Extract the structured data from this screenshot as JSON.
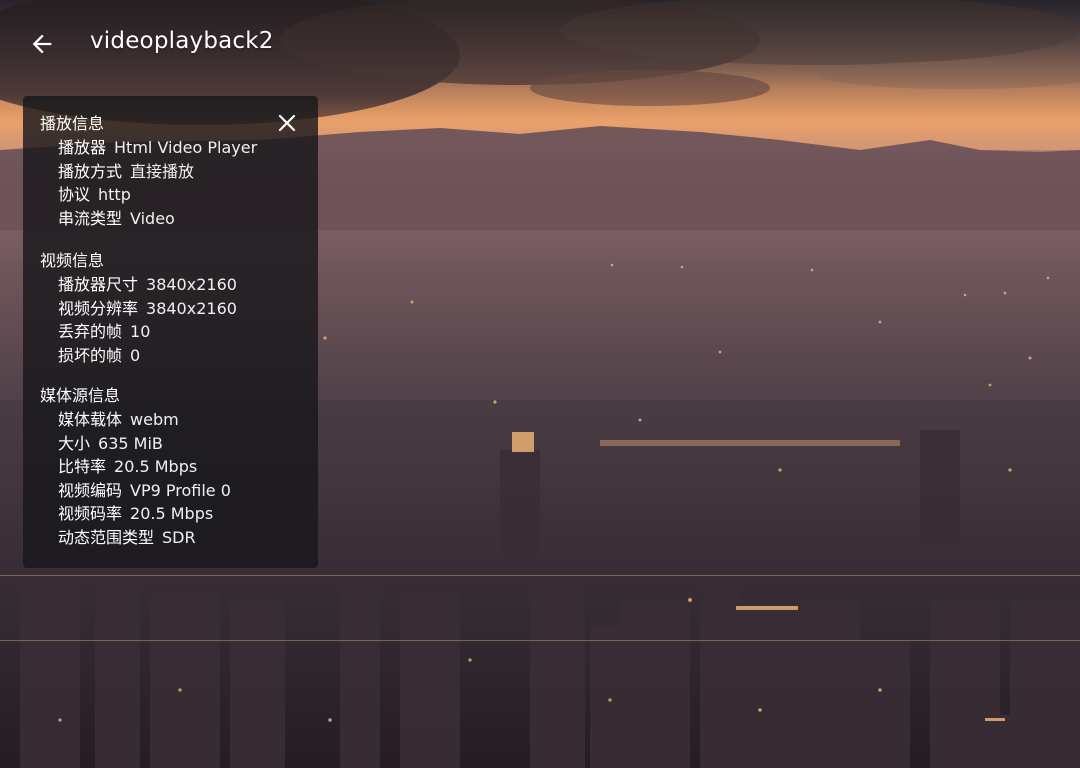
{
  "header": {
    "back_icon": "arrow-left-icon",
    "title": "videoplayback2"
  },
  "stats_panel": {
    "close_icon": "close-icon",
    "sections": [
      {
        "title": "播放信息",
        "rows": [
          {
            "label": "播放器",
            "value": "Html Video Player"
          },
          {
            "label": "播放方式",
            "value": "直接播放"
          },
          {
            "label": "协议",
            "value": "http"
          },
          {
            "label": "串流类型",
            "value": "Video"
          }
        ]
      },
      {
        "title": "视频信息",
        "rows": [
          {
            "label": "播放器尺寸",
            "value": "3840x2160"
          },
          {
            "label": "视频分辨率",
            "value": "3840x2160"
          },
          {
            "label": "丢弃的帧",
            "value": "10"
          },
          {
            "label": "损坏的帧",
            "value": "0"
          }
        ]
      },
      {
        "title": "媒体源信息",
        "rows": [
          {
            "label": "媒体载体",
            "value": "webm"
          },
          {
            "label": "大小",
            "value": "635 MiB"
          },
          {
            "label": "比特率",
            "value": "20.5 Mbps"
          },
          {
            "label": "视频编码",
            "value": "VP9 Profile 0"
          },
          {
            "label": "视频码率",
            "value": "20.5 Mbps"
          },
          {
            "label": "动态范围类型",
            "value": "SDR"
          }
        ]
      }
    ]
  }
}
